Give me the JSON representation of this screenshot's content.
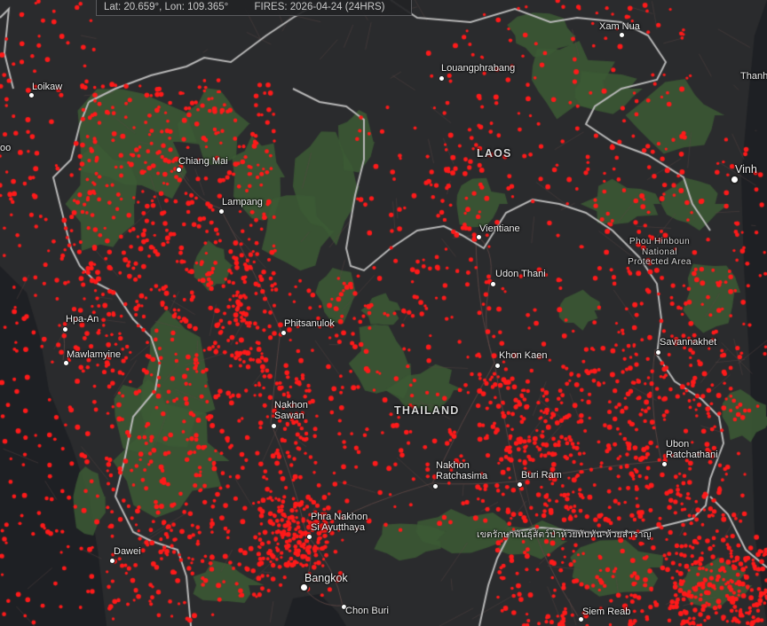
{
  "status": {
    "coords": "Lat: 20.659°, Lon: 109.365°",
    "fires": "FIRES: 2026-04-24 (24HRS)"
  },
  "colors": {
    "background": "#2a2b2d",
    "sea": "#1e2024",
    "forest": "#3c5a35",
    "border": "#b8b8b8",
    "road": "#5c4644",
    "fire": "#ff1a1a"
  },
  "labels": {
    "xam_nua": "Xam Nua",
    "loikaw": "Loikaw",
    "louangphrabang": "Louangphrabang",
    "thanh": "Thanh",
    "chiang_mai": "Chiang Mai",
    "lampang": "Lampang",
    "laos": "LAOS",
    "vinh": "Vinh",
    "vientiane": "Vientiane",
    "park_line1": "Phou Hinboun",
    "park_line2": "National",
    "park_line3": "Protected Area",
    "udon_thani": "Udon Thani",
    "hpa_an": "Hpa-An",
    "phitsanulok": "Phitsanulok",
    "savannakhet": "Savannakhet",
    "mawlamyine": "Mawlamyine",
    "khon_kaen": "Khon Kaen",
    "nakhon_sawan_1": "Nakhon",
    "nakhon_sawan_2": "Sawan",
    "thailand": "THAILAND",
    "ubon_1": "Ubon",
    "ubon_2": "Ratchathani",
    "nakhon_ratchasima_1": "Nakhon",
    "nakhon_ratchasima_2": "Ratchasima",
    "buri_ram": "Buri Ram",
    "ayutthaya_1": "Phra Nakhon",
    "ayutthaya_2": "Si Ayutthaya",
    "thai_sanctuary": "เขตรักษาพันธุ์สัตว์ป่าห้วยทับทัน-ห้วยสำราญ",
    "dawei": "Dawei",
    "bangkok": "Bangkok",
    "chon_buri": "Chon Buri",
    "siem_reab": "Siem Reab",
    "edge_left": "oo"
  },
  "fire_clusters": [
    {
      "area": "northern-thailand",
      "density": "very-high"
    },
    {
      "area": "myanmar-border",
      "density": "high"
    },
    {
      "area": "central-plain",
      "density": "high"
    },
    {
      "area": "isan-plateau",
      "density": "medium"
    },
    {
      "area": "laos-east",
      "density": "medium"
    },
    {
      "area": "cambodia",
      "density": "high"
    }
  ]
}
